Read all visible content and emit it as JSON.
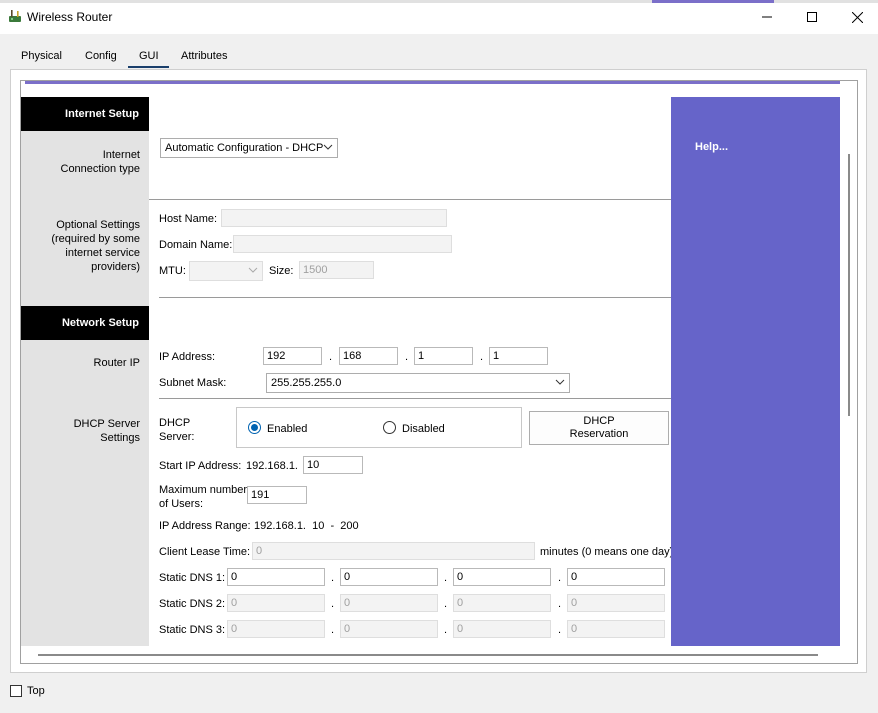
{
  "window": {
    "title": "Wireless Router",
    "icon": "router-icon"
  },
  "tabs": [
    {
      "label": "Physical"
    },
    {
      "label": "Config"
    },
    {
      "label": "GUI"
    },
    {
      "label": "Attributes"
    }
  ],
  "active_tab": "GUI",
  "sections": {
    "internet_setup": "Internet Setup",
    "network_setup": "Network Setup"
  },
  "left_labels": {
    "connection_type": [
      "Internet",
      "Connection type"
    ],
    "optional_settings": [
      "Optional Settings",
      "(required by some",
      "internet service",
      "providers)"
    ],
    "router_ip": "Router IP",
    "dhcp_server_settings": [
      "DHCP Server",
      "Settings"
    ]
  },
  "internet": {
    "connection_type_value": "Automatic Configuration - DHCP",
    "host_name_label": "Host Name:",
    "host_name_value": "",
    "domain_name_label": "Domain Name:",
    "domain_name_value": "",
    "mtu_label": "MTU:",
    "mtu_value": "",
    "size_label": "Size:",
    "size_value": "1500"
  },
  "router_ip": {
    "ip_label": "IP Address:",
    "ip": [
      "192",
      "168",
      "1",
      "1"
    ],
    "subnet_label": "Subnet Mask:",
    "subnet_value": "255.255.255.0"
  },
  "dhcp": {
    "server_label": [
      "DHCP",
      "Server:"
    ],
    "enabled_label": "Enabled",
    "disabled_label": "Disabled",
    "selected": "Enabled",
    "reservation_button": [
      "DHCP",
      "Reservation"
    ],
    "start_ip_label": "Start IP Address:",
    "start_ip_prefix": "192.168.1.",
    "start_ip_value": "10",
    "max_users_label": [
      "Maximum number",
      "of Users:"
    ],
    "max_users_value": "191",
    "range_label": "IP Address Range:",
    "range_value": "192.168.1.  10  -  200",
    "lease_label": "Client Lease Time:",
    "lease_value": "0",
    "lease_hint": "minutes (0 means one day)",
    "dns1_label": "Static DNS 1:",
    "dns1": [
      "0",
      "0",
      "0",
      "0"
    ],
    "dns2_label": "Static DNS 2:",
    "dns2": [
      "0",
      "0",
      "0",
      "0"
    ],
    "dns3_label": "Static DNS 3:",
    "dns3": [
      "0",
      "0",
      "0",
      "0"
    ]
  },
  "help": {
    "label": "Help..."
  },
  "footer": {
    "top_label": "Top",
    "top_checked": false
  },
  "colors": {
    "help_panel": "#6664c9",
    "section_header": "#000000",
    "left_column": "#e3e3e3",
    "accent": "#0063b1"
  }
}
